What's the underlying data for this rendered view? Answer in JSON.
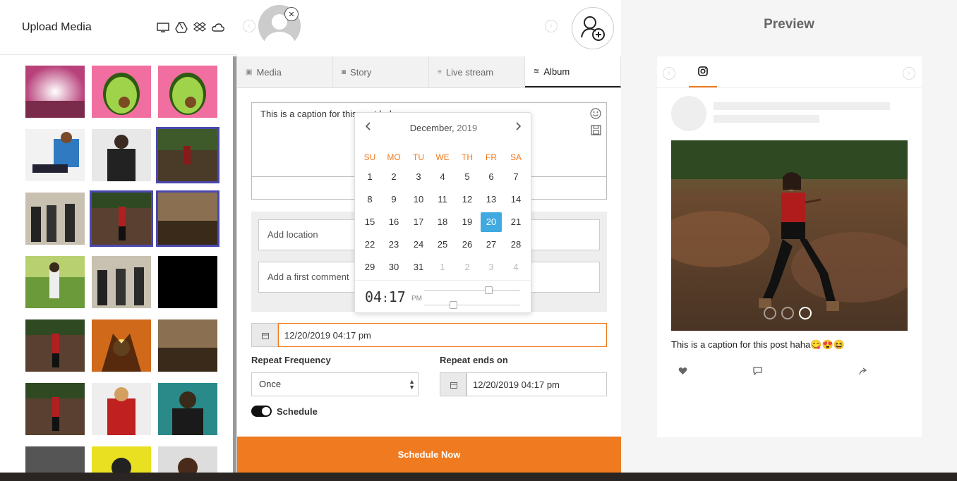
{
  "left_panel": {
    "title": "Upload Media",
    "source_icons": [
      "desktop-icon",
      "google-drive-icon",
      "dropbox-icon",
      "cloud-icon"
    ]
  },
  "account": {
    "remove_symbol": "✕",
    "prev_symbol": "‹",
    "next_symbol": "›"
  },
  "tabs": [
    {
      "label": "Media",
      "icon": "image-icon"
    },
    {
      "label": "Story",
      "icon": "camera-icon"
    },
    {
      "label": "Live stream",
      "icon": "stream-icon"
    },
    {
      "label": "Album",
      "icon": "album-icon",
      "active": true
    }
  ],
  "composer": {
    "caption_value": "This is a caption for this post haha",
    "location_placeholder": "Add location",
    "first_comment_placeholder": "Add a first comment",
    "schedule_datetime": "12/20/2019 04:17 pm",
    "repeat_frequency_label": "Repeat Frequency",
    "repeat_frequency_value": "Once",
    "repeat_ends_label": "Repeat ends on",
    "repeat_ends_value": "12/20/2019 04:17 pm",
    "schedule_toggle_label": "Schedule",
    "schedule_button": "Schedule Now"
  },
  "calendar": {
    "month": "December,",
    "year": "2019",
    "weekdays": [
      "SU",
      "MO",
      "TU",
      "WE",
      "TH",
      "FR",
      "SA"
    ],
    "weeks": [
      [
        "1",
        "2",
        "3",
        "4",
        "5",
        "6",
        "7"
      ],
      [
        "8",
        "9",
        "10",
        "11",
        "12",
        "13",
        "14"
      ],
      [
        "15",
        "16",
        "17",
        "18",
        "19",
        "20",
        "21"
      ],
      [
        "22",
        "23",
        "24",
        "25",
        "26",
        "27",
        "28"
      ],
      [
        "29",
        "30",
        "31",
        "1",
        "2",
        "3",
        "4"
      ]
    ],
    "selected_day": "20",
    "hour": "04",
    "minute": "17",
    "ampm": "PM"
  },
  "preview": {
    "title": "Preview",
    "caption": "This is a caption for this post haha😋😍😆",
    "carousel_count": 3,
    "carousel_active": 2
  }
}
